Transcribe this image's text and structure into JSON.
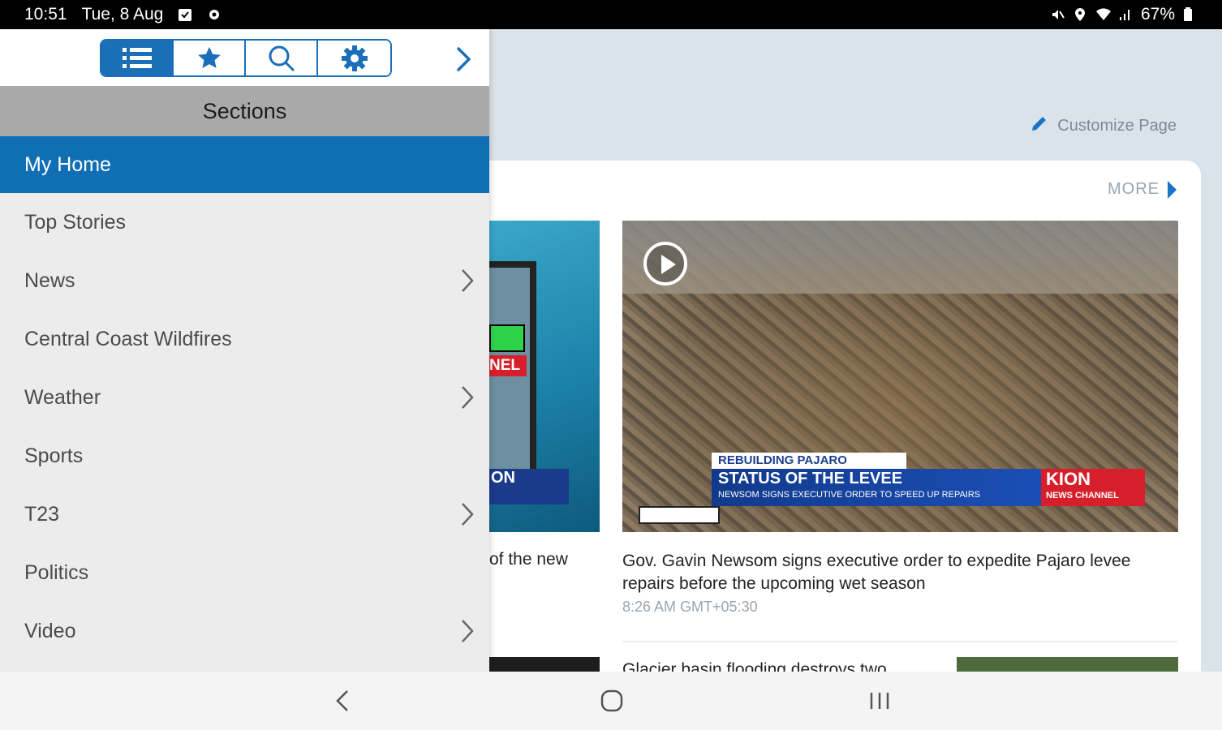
{
  "status_bar": {
    "time": "10:51",
    "date": "Tue, 8 Aug",
    "battery": "67%"
  },
  "drawer": {
    "tabs": [
      {
        "icon": "list-icon",
        "active": true
      },
      {
        "icon": "star-icon",
        "active": false
      },
      {
        "icon": "search-icon",
        "active": false
      },
      {
        "icon": "gear-icon",
        "active": false
      }
    ],
    "header": "Sections",
    "items": [
      {
        "label": "My Home",
        "active": true,
        "has_children": false
      },
      {
        "label": "Top Stories",
        "has_children": false
      },
      {
        "label": "News",
        "has_children": true
      },
      {
        "label": "Central Coast Wildfires",
        "has_children": false
      },
      {
        "label": "Weather",
        "has_children": true
      },
      {
        "label": "Sports",
        "has_children": false
      },
      {
        "label": "T23",
        "has_children": true
      },
      {
        "label": "Politics",
        "has_children": false
      },
      {
        "label": "Video",
        "has_children": true
      }
    ]
  },
  "content": {
    "customize_label": "Customize Page",
    "more_label": "MORE",
    "left_story": {
      "caption_fragment": "of the new",
      "badge_text": "NEL",
      "brand_text": "ON"
    },
    "main_story": {
      "headline": "Gov. Gavin Newsom signs executive order to expedite Pajaro levee repairs before the upcoming wet season",
      "time": "8:26 AM GMT+05:30",
      "overlay_kicker": "REBUILDING PAJARO",
      "overlay_title": "STATUS OF THE LEVEE",
      "overlay_sub": "NEWSOM SIGNS EXECUTIVE ORDER TO SPEED UP REPAIRS",
      "overlay_brand": "KION",
      "overlay_brand_sub": "NEWS CHANNEL"
    },
    "next_story": {
      "headline_fragment": "Glacier basin flooding destroys two"
    }
  },
  "colors": {
    "accent": "#0f6eb4",
    "brand_red": "#d61f2b"
  }
}
